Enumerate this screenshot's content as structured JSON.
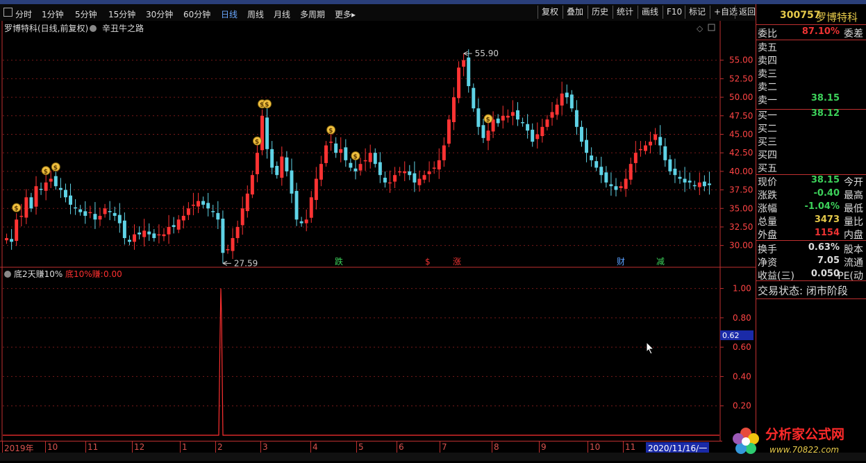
{
  "toolbar": {
    "periods": [
      "分时",
      "1分钟",
      "5分钟",
      "15分钟",
      "30分钟",
      "60分钟",
      "日线",
      "周线",
      "月线",
      "多周期",
      "更多▸"
    ],
    "active_period": "日线",
    "buttons": [
      "复权",
      "叠加",
      "历史",
      "统计",
      "画线",
      "F10",
      "标记",
      "+自选",
      "返回"
    ]
  },
  "main_chart": {
    "title": "罗博特科(日线,前复权)",
    "indicator": "辛丑牛之路",
    "y_ticks": [
      "55.00",
      "52.50",
      "50.00",
      "47.50",
      "45.00",
      "42.50",
      "40.00",
      "37.50",
      "35.00",
      "32.50",
      "30.00"
    ],
    "high_label": "55.90",
    "low_label": "27.59",
    "event_labels": [
      {
        "text": "跌",
        "color": "#3cd15a"
      },
      {
        "text": "$",
        "color": "#e33"
      },
      {
        "text": "涨",
        "color": "#e33"
      },
      {
        "text": "财",
        "color": "#5aa0ff"
      },
      {
        "text": "减",
        "color": "#3cd15a"
      }
    ]
  },
  "sub_chart": {
    "title": "底2天赚10%",
    "line_name": "底10%赚:",
    "line_value": "0.00",
    "y_ticks": [
      "1.00",
      "0.80",
      "0.60",
      "0.40",
      "0.20"
    ],
    "crosshair_value": "0.62"
  },
  "date_axis": {
    "labels": [
      "2019年",
      "10",
      "11",
      "12",
      "1",
      "2",
      "3",
      "4",
      "5",
      "6",
      "7",
      "8",
      "9",
      "10",
      "11"
    ],
    "current_date": "2020/11/16/一"
  },
  "quote_panel": {
    "code": "300757",
    "name": "罗博特科",
    "webi_label": "委比",
    "webi_value": "87.10%",
    "weicha_label": "委差",
    "asks": [
      {
        "label": "卖五",
        "price": ""
      },
      {
        "label": "卖四",
        "price": ""
      },
      {
        "label": "卖三",
        "price": ""
      },
      {
        "label": "卖二",
        "price": ""
      },
      {
        "label": "卖一",
        "price": "38.15"
      }
    ],
    "bids": [
      {
        "label": "买一",
        "price": "38.12"
      },
      {
        "label": "买二",
        "price": ""
      },
      {
        "label": "买三",
        "price": ""
      },
      {
        "label": "买四",
        "price": ""
      },
      {
        "label": "买五",
        "price": ""
      }
    ],
    "stats": [
      {
        "label": "现价",
        "value": "38.15",
        "right": "今开",
        "color": "#3cd15a"
      },
      {
        "label": "涨跌",
        "value": "-0.40",
        "right": "最高",
        "color": "#3cd15a"
      },
      {
        "label": "涨幅",
        "value": "-1.04%",
        "right": "最低",
        "color": "#3cd15a"
      },
      {
        "label": "总量",
        "value": "3473",
        "right": "量比",
        "color": "#e5c94a"
      },
      {
        "label": "外盘",
        "value": "1154",
        "right": "内盘",
        "color": "#e33"
      }
    ],
    "stats2": [
      {
        "label": "换手",
        "value": "0.63%",
        "right": "股本",
        "color": "#ddd"
      },
      {
        "label": "净资",
        "value": "7.05",
        "right": "流通",
        "color": "#ddd"
      },
      {
        "label": "收益(三)",
        "value": "0.050",
        "right": "PE(动",
        "color": "#ddd"
      }
    ],
    "trade_state": "交易状态: 闭市阶段"
  },
  "watermark": {
    "text": "分析家公式网",
    "url": "www.70822.com"
  },
  "colors": {
    "up": "#ff3333",
    "down": "#5fd3e6",
    "grid": "#7a1a1a",
    "frame": "#c03030",
    "accent_blue": "#1a2aa8"
  },
  "chart_data": {
    "type": "candlestick",
    "close": [
      31.0,
      30.5,
      33.5,
      34.0,
      36.5,
      35.0,
      38.0,
      37.5,
      38.5,
      39.0,
      38.0,
      37.5,
      36.5,
      35.5,
      35.0,
      34.5,
      34.0,
      34.5,
      33.5,
      34.0,
      35.0,
      34.5,
      34.0,
      33.0,
      31.0,
      30.5,
      31.5,
      31.5,
      32.0,
      31.5,
      31.0,
      31.5,
      31.5,
      32.5,
      32.5,
      33.5,
      34.0,
      35.0,
      35.5,
      36.0,
      35.5,
      35.0,
      34.5,
      33.5,
      29.0,
      29.5,
      31.0,
      32.5,
      35.0,
      37.0,
      39.5,
      42.5,
      47.5,
      43.0,
      40.5,
      39.5,
      42.0,
      40.0,
      37.0,
      33.5,
      33.0,
      33.5,
      36.5,
      39.0,
      41.0,
      43.5,
      44.0,
      42.5,
      43.0,
      41.5,
      40.5,
      40.0,
      41.0,
      41.5,
      42.5,
      41.0,
      39.5,
      38.5,
      38.5,
      39.5,
      40.0,
      40.0,
      39.5,
      38.5,
      39.0,
      39.5,
      40.0,
      40.5,
      41.5,
      43.5,
      47.0,
      50.0,
      54.0,
      55.0,
      51.5,
      48.5,
      46.0,
      44.5,
      45.5,
      47.0,
      46.5,
      47.5,
      47.5,
      48.0,
      47.0,
      46.5,
      45.5,
      44.0,
      45.0,
      46.0,
      47.0,
      48.0,
      49.0,
      50.5,
      50.0,
      48.5,
      46.0,
      44.0,
      42.5,
      41.5,
      40.5,
      39.5,
      38.5,
      38.0,
      37.5,
      38.0,
      39.0,
      41.0,
      42.5,
      43.0,
      43.5,
      44.0,
      45.0,
      43.5,
      41.5,
      40.0,
      39.5,
      39.0,
      38.5,
      38.5,
      38.0,
      38.5,
      38.0,
      38.15
    ],
    "high_price": 55.9,
    "low_price": 27.59,
    "y_range": [
      28.0,
      57.5
    ],
    "x_range": [
      "2019-09",
      "2020-11-16"
    ],
    "indicator": {
      "name": "底10%赚",
      "values": "0 everywhere except a single spike to 1.00 in early February 2020",
      "y_range": [
        0,
        1.05
      ]
    }
  }
}
